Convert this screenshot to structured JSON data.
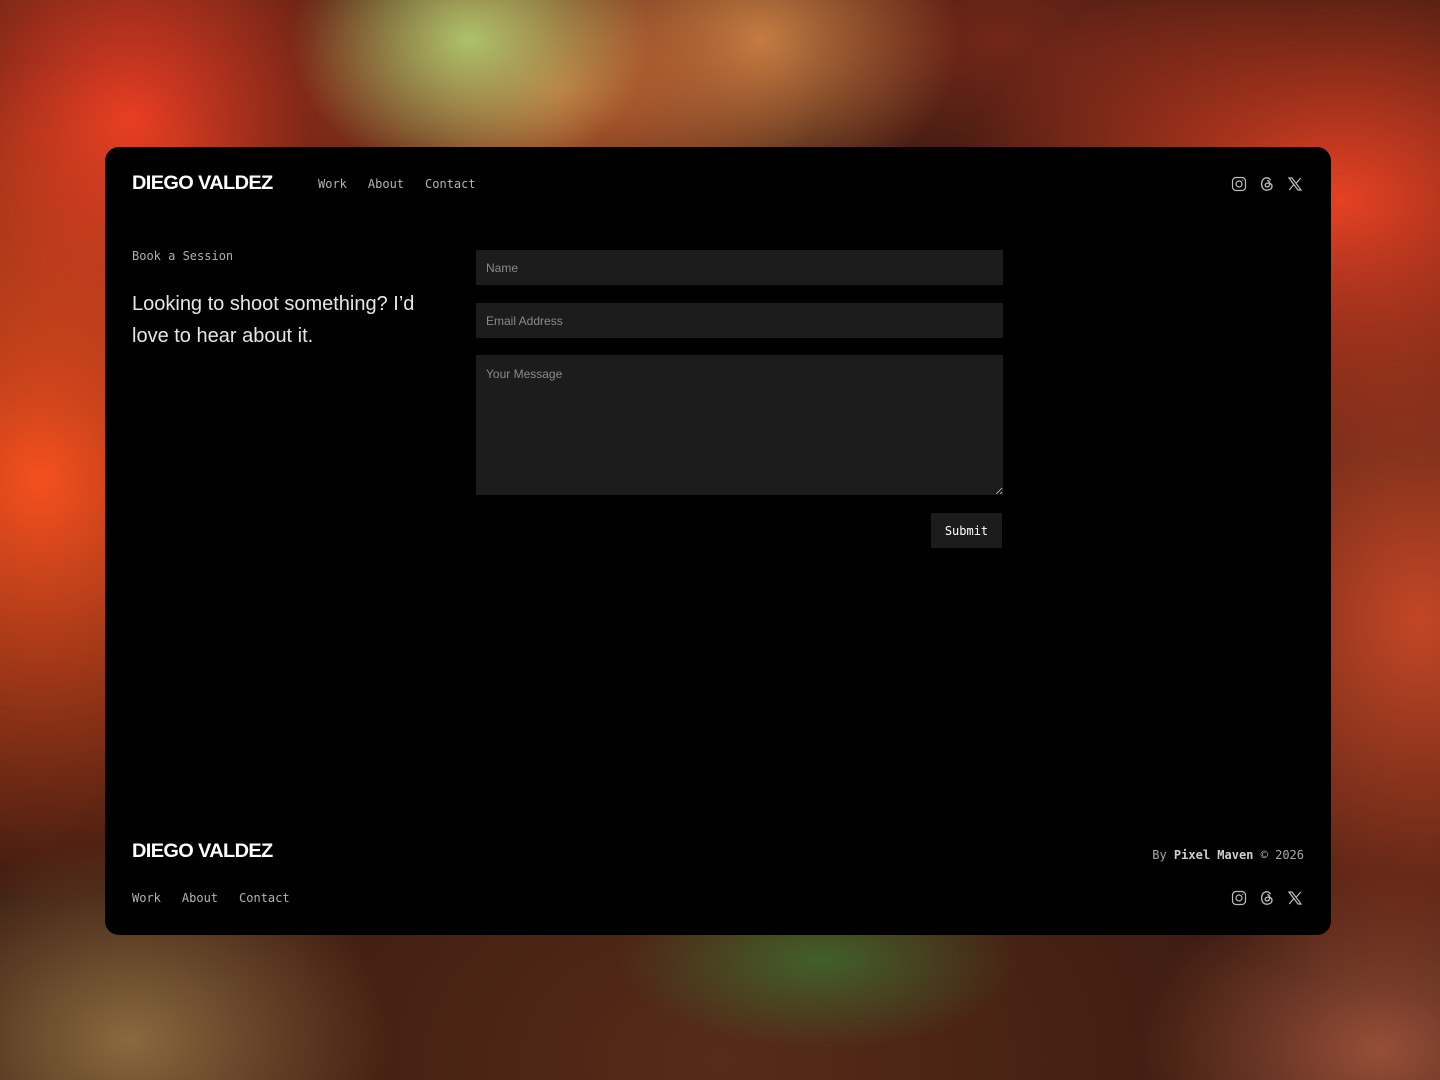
{
  "brand": "DIEGO VALDEZ",
  "header": {
    "nav": [
      "Work",
      "About",
      "Contact"
    ]
  },
  "socials": [
    {
      "name": "instagram-icon"
    },
    {
      "name": "threads-icon"
    },
    {
      "name": "x-icon"
    }
  ],
  "contact": {
    "eyebrow": "Book a Session",
    "lead": "Looking to shoot something? I’d love to hear about it.",
    "name_placeholder": "Name",
    "email_placeholder": "Email Address",
    "message_placeholder": "Your Message",
    "submit_label": "Submit"
  },
  "footer": {
    "nav": [
      "Work",
      "About",
      "Contact"
    ],
    "credit_prefix": "By",
    "credit_name": "Pixel Maven",
    "credit_suffix": "© 2026"
  },
  "colors": {
    "panel": "#000000",
    "field": "#1c1c1c",
    "accent_bg": "#e94a2a"
  }
}
